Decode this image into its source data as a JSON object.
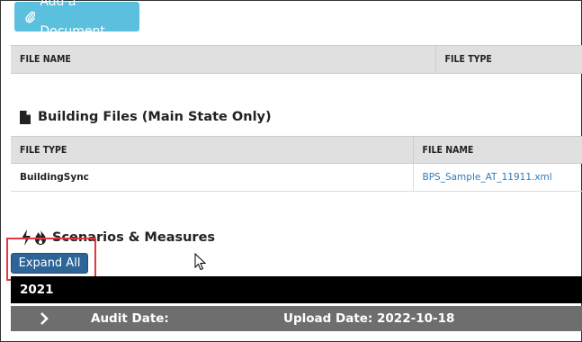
{
  "toolbar": {
    "add_document_label": "Add a Document"
  },
  "documents_table": {
    "columns": [
      "FILE NAME",
      "FILE TYPE"
    ]
  },
  "building_files": {
    "title": "Building Files (Main State Only)",
    "columns": [
      "FILE TYPE",
      "FILE NAME"
    ],
    "rows": [
      {
        "file_type": "BuildingSync",
        "file_name": "BPS_Sample_AT_11911.xml"
      }
    ]
  },
  "scenarios": {
    "title": "Scenarios & Measures",
    "expand_all_label": "Expand All",
    "year": "2021",
    "audit_date_label": "Audit Date:",
    "upload_date_label": "Upload Date: 2022-10-18"
  },
  "colors": {
    "add_button": "#5bc0de",
    "expand_button": "#2e6598",
    "link": "#337ab7",
    "highlight": "#e0393e",
    "year_bar": "#000000",
    "audit_bar": "#6e6e6e"
  }
}
